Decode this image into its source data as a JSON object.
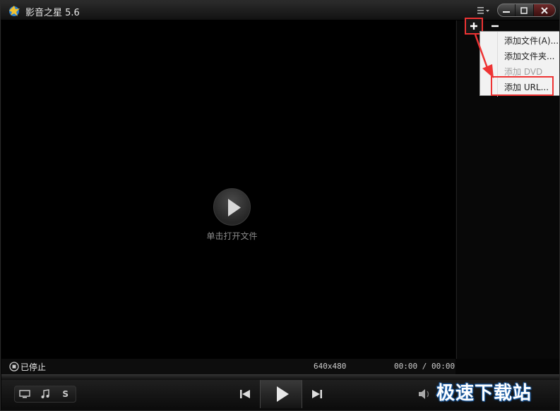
{
  "window": {
    "title": "影音之星 5.6",
    "controls": {
      "minimize": "minimize-icon",
      "maximize": "maximize-icon",
      "close": "close-icon"
    }
  },
  "video": {
    "open_hint": "单击打开文件"
  },
  "playlist": {
    "add_symbol": "+",
    "remove_symbol": "−",
    "add_menu": [
      {
        "label": "添加文件(A)...",
        "enabled": true
      },
      {
        "label": "添加文件夹...",
        "enabled": true
      },
      {
        "label": "添加 DVD",
        "enabled": false
      },
      {
        "label": "添加 URL...",
        "enabled": true,
        "highlighted": true
      }
    ]
  },
  "status": {
    "state": "已停止",
    "resolution": "640x480",
    "time": "00:00 / 00:00"
  },
  "controls": {
    "mode_buttons": [
      "video-mode-icon",
      "music-mode-icon",
      "S"
    ],
    "s_label": "S"
  },
  "watermark": "极速下载站",
  "colors": {
    "annotation_red": "#e33333",
    "background": "#000000",
    "menu_background": "#f2f2f2"
  }
}
